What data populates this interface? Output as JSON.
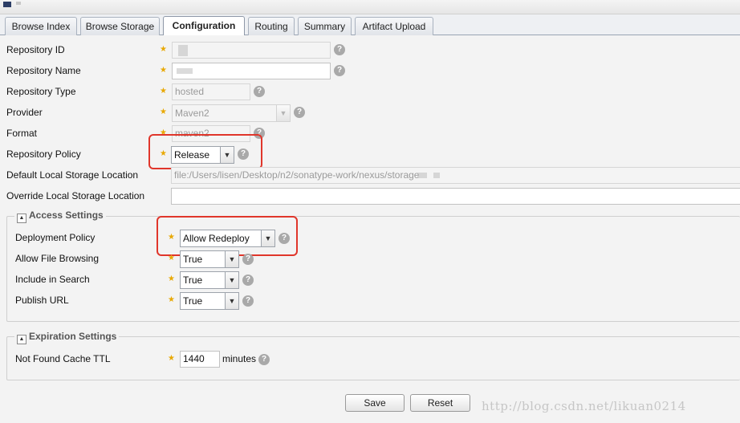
{
  "tabs": [
    "Browse Index",
    "Browse Storage",
    "Configuration",
    "Routing",
    "Summary",
    "Artifact Upload"
  ],
  "active_tab": "Configuration",
  "form": {
    "repository_id": {
      "label": "Repository ID",
      "value": ""
    },
    "repository_name": {
      "label": "Repository Name",
      "value": ""
    },
    "repository_type": {
      "label": "Repository Type",
      "value": "hosted"
    },
    "provider": {
      "label": "Provider",
      "value": "Maven2"
    },
    "format": {
      "label": "Format",
      "value": "maven2"
    },
    "repository_policy": {
      "label": "Repository Policy",
      "value": "Release"
    },
    "default_local_storage": {
      "label": "Default Local Storage Location",
      "value": "file:/Users/lisen/Desktop/n2/sonatype-work/nexus/storage"
    },
    "override_local_storage": {
      "label": "Override Local Storage Location",
      "value": ""
    }
  },
  "access_settings": {
    "title": "Access Settings",
    "deployment_policy": {
      "label": "Deployment Policy",
      "value": "Allow Redeploy"
    },
    "allow_file_browsing": {
      "label": "Allow File Browsing",
      "value": "True"
    },
    "include_in_search": {
      "label": "Include in Search",
      "value": "True"
    },
    "publish_url": {
      "label": "Publish URL",
      "value": "True"
    }
  },
  "expiration_settings": {
    "title": "Expiration Settings",
    "not_found_cache_ttl": {
      "label": "Not Found Cache TTL",
      "value": "1440",
      "unit": "minutes"
    }
  },
  "buttons": {
    "save": "Save",
    "reset": "Reset"
  },
  "icons": {
    "required": "star-icon",
    "help": "help-icon",
    "dropdown": "chevron-down-icon",
    "collapse": "collapse-icon"
  },
  "help_glyph": "?",
  "watermark": "http://blog.csdn.net/likuan0214",
  "colors": {
    "required_star": "#e8a800",
    "highlight_box": "#e0362b",
    "help_icon": "#a9a9a9"
  }
}
